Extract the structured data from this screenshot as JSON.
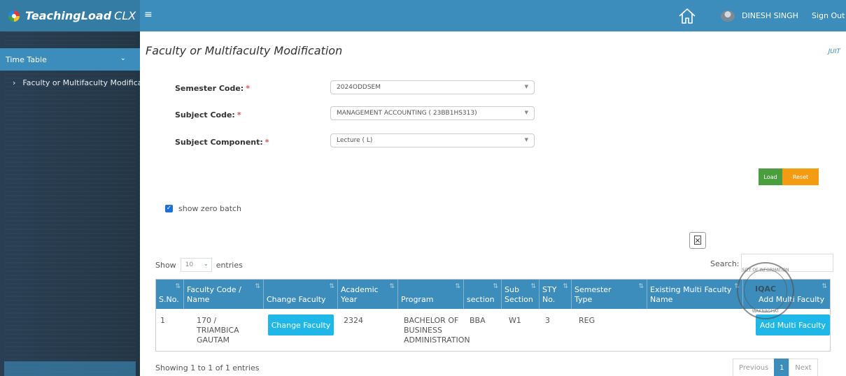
{
  "app": {
    "name": "TeachingLoad",
    "name_suffix": "CLX",
    "menu_icon": "hamburger-icon"
  },
  "header": {
    "home_icon": "home-icon",
    "user_name": "DINESH SINGH",
    "signout_label": "Sign Out"
  },
  "sidebar": {
    "section_label": "Time Table",
    "items": [
      {
        "label": "Faculty or Multifaculty Modificat"
      }
    ]
  },
  "page": {
    "title": "Faculty or Multifaculty Modification",
    "tag": "JUIT"
  },
  "form": {
    "semester_label": "Semester Code:",
    "semester_value": "2024ODDSEM",
    "subject_label": "Subject Code:",
    "subject_value": "MANAGEMENT ACCOUNTING ( 23BB1HS313)",
    "component_label": "Subject Component:",
    "component_value": "Lecture ( L)",
    "required_mark": "*",
    "load_label": "Load",
    "reset_label": "Reset",
    "zero_batch_label": "show zero batch",
    "zero_batch_checked": "✓"
  },
  "table_controls": {
    "show_label": "Show",
    "entries_label": "entries",
    "page_length": "10",
    "search_label": "Search:",
    "search_value": ""
  },
  "table": {
    "columns": [
      "S.No.",
      "Faculty Code / Name",
      "Change Faculty",
      "Academic Year",
      "Program",
      "section",
      "Sub Section",
      "STY No.",
      "Semester Type",
      "Existing Multi Faculty Name",
      "Add Multi Faculty"
    ],
    "rows": [
      {
        "sno": "1",
        "faculty": "170 / TRIAMBICA GAUTAM",
        "change_label": "Change Faculty",
        "academic_year": "2324",
        "program": "BACHELOR OF BUSINESS ADMINISTRATION",
        "section": "BBA",
        "sub_section": "W1",
        "sty_no": "3",
        "semester_type": "REG",
        "existing": "",
        "add_label": "Add Multi Faculty"
      }
    ]
  },
  "stamp": {
    "top_text": "SITY OF INFORMATION",
    "center_text": "IQAC",
    "bottom_text": "WAKNAGHAT"
  },
  "footer": {
    "info": "Showing 1 to 1 of 1 entries",
    "previous": "Previous",
    "current_page": "1",
    "next": "Next"
  }
}
